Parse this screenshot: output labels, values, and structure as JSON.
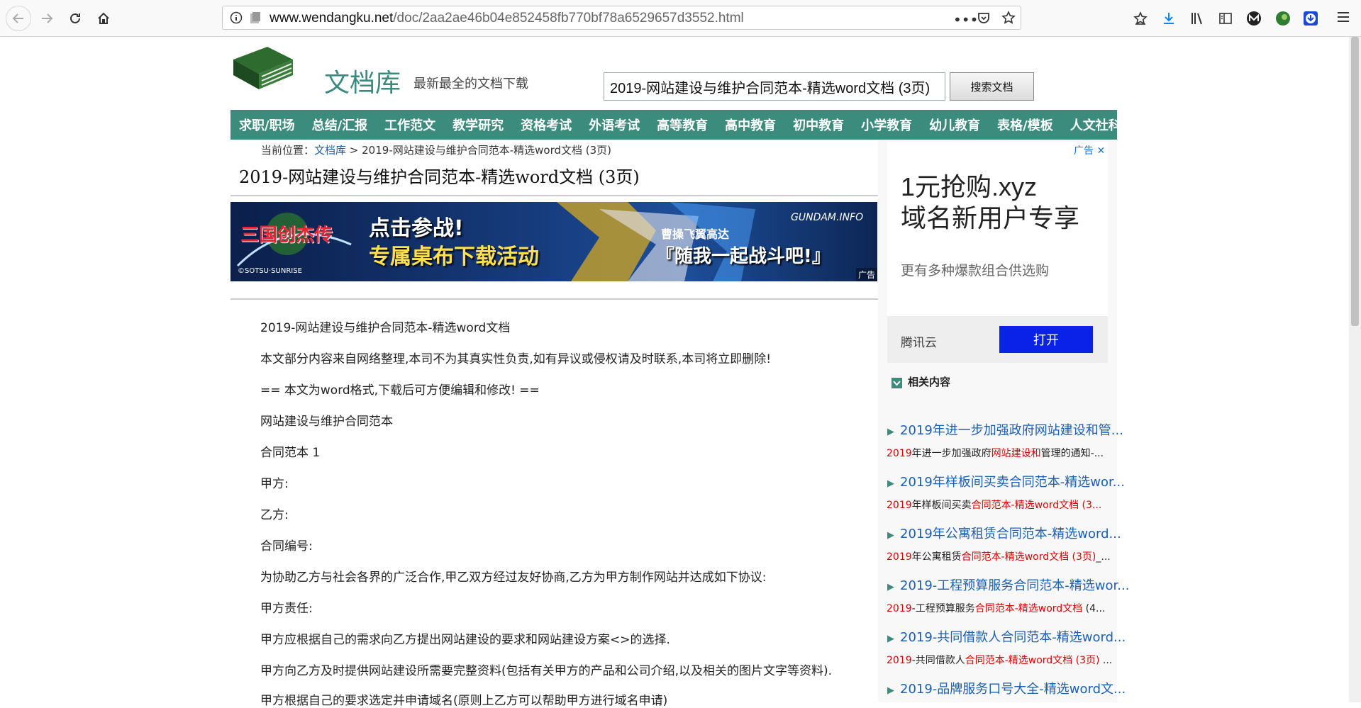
{
  "browser": {
    "url_host": "www.wendangku.net",
    "url_path": "/doc/2aa2ae46b04e852458fb770bf78a6529657d3552.html"
  },
  "site": {
    "title": "文档库",
    "slogan": "最新最全的文档下载",
    "search_value": "2019-网站建设与维护合同范本-精选word文档 (3页)",
    "search_button": "搜索文档"
  },
  "nav": [
    "求职/职场",
    "总结/汇报",
    "工作范文",
    "教学研究",
    "资格考试",
    "外语考试",
    "高等教育",
    "高中教育",
    "初中教育",
    "小学教育",
    "幼儿教育",
    "表格/模板",
    "人文社科"
  ],
  "breadcrumb": {
    "prefix": "当前位置：",
    "home": "文档库",
    "sep": " > ",
    "current": "2019-网站建设与维护合同范本-精选word文档 (3页)"
  },
  "doc_title": "2019-网站建设与维护合同范本-精选word文档 (3页)",
  "banner": {
    "logo": "三国创杰传",
    "line1": "点击参战!",
    "line2": "专属桌布下载活动",
    "line3": "曹操飞翼高达",
    "line4": "『随我一起战斗吧!』",
    "brand": "GUNDAM.INFO",
    "copyright": "©SOTSU·SUNRISE",
    "ad_label": "广告"
  },
  "content": [
    "2019-网站建设与维护合同范本-精选word文档",
    "本文部分内容来自网络整理,本司不为其真实性负责,如有异议或侵权请及时联系,本司将立即删除!",
    "== 本文为word格式,下载后可方便编辑和修改! ==",
    "网站建设与维护合同范本",
    "合同范本 1",
    "甲方:",
    "乙方:",
    "合同编号:",
    "为协助乙方与社会各界的广泛合作,甲乙双方经过友好协商,乙方为甲方制作网站并达成如下协议:",
    "甲方责任:",
    "甲方应根据自己的需求向乙方提出网站建设的要求和网站建设方案<>的选择.",
    "甲方向乙方及时提供网站建设所需要完整资料(包括有关甲方的产品和公司介绍,以及相关的图片文字等资料).",
    "甲方根据自己的要求选定并申请域名(原则上乙方可以帮助甲方进行域名申请)"
  ],
  "ad": {
    "tag": "广告",
    "headline1": "1元抢购.xyz",
    "headline2": "域名新用户专享",
    "subtitle": "更有多种爆款组合供选购",
    "brand": "腾讯云",
    "button": "打开"
  },
  "related": {
    "heading": "相关内容",
    "items": [
      {
        "title": "2019年进一步加强政府网站建设和管...",
        "snip_a": "2019",
        "snip_b": "年进一步加强政府",
        "snip_c": "网站建设和",
        "snip_d": "管理的通知-..."
      },
      {
        "title": "2019年样板间买卖合同范本-精选wor...",
        "snip_a": "2019",
        "snip_b": "年样板间买卖",
        "snip_c": "合同范本-精选word文档 (3...",
        "snip_d": ""
      },
      {
        "title": "2019年公寓租赁合同范本-精选word...",
        "snip_a": "2019",
        "snip_b": "年公寓租赁",
        "snip_c": "合同范本-精选word文档 (3页)",
        "snip_d": "_..."
      },
      {
        "title": "2019-工程预算服务合同范本-精选wor...",
        "snip_a": "2019",
        "snip_b": "-工程预算服务",
        "snip_c": "合同范本-精选word文档",
        "snip_d": " (4..."
      },
      {
        "title": "2019-共同借款人合同范本-精选word...",
        "snip_a": "2019",
        "snip_b": "-共同借款人",
        "snip_c": "合同范本-精选word文档 (3页)",
        "snip_d": " ..."
      },
      {
        "title": "2019-品牌服务口号大全-精选word文...",
        "snip_a": "",
        "snip_b": "",
        "snip_c": "",
        "snip_d": ""
      }
    ]
  }
}
